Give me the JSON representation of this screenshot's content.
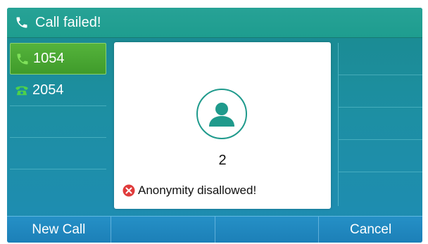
{
  "status_bar": {
    "title": "Call failed!",
    "icon": "handset-icon"
  },
  "lines": [
    {
      "number": "1054",
      "active": true,
      "icon": "handset-icon"
    },
    {
      "number": "2054",
      "active": false,
      "icon": "phone-icon"
    }
  ],
  "dialog": {
    "callee": "2",
    "message": "Anonymity disallowed!",
    "avatar_icon": "contact-avatar-icon",
    "error_icon": "error-x-icon"
  },
  "softkeys": [
    {
      "label": "New Call"
    },
    {
      "label": ""
    },
    {
      "label": ""
    },
    {
      "label": "Cancel"
    }
  ],
  "colors": {
    "accent": "#1f9a8c",
    "line_active": "#4aa832",
    "error": "#e03b3b",
    "softbar": "#1f86bd"
  }
}
